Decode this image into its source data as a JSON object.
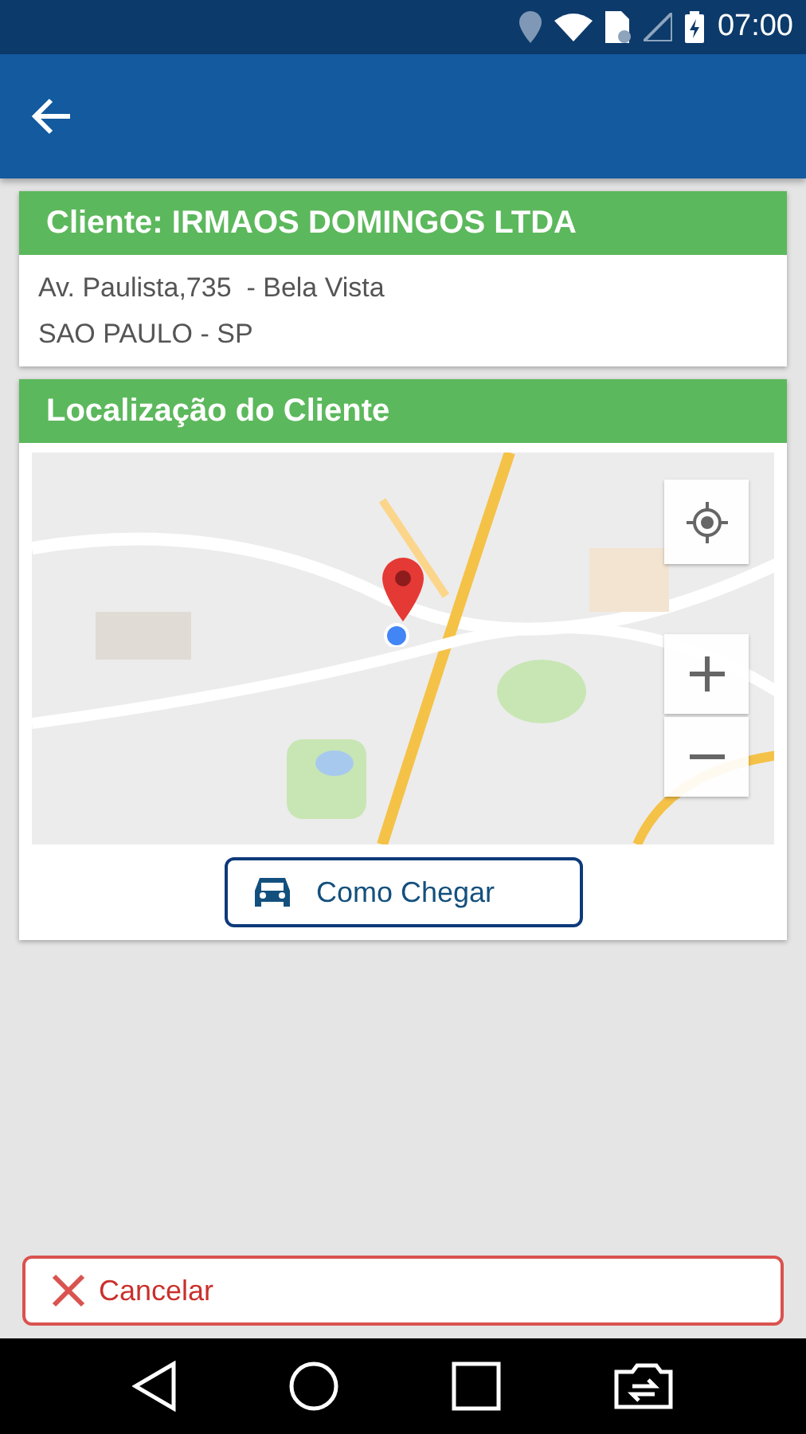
{
  "status_bar": {
    "time": "07:00"
  },
  "client_card": {
    "title": "Cliente: IRMAOS DOMINGOS LTDA",
    "address_lines": [
      "Av. Paulista,735  - Bela Vista",
      "SAO PAULO - SP"
    ]
  },
  "location_card": {
    "title": "Localização do Cliente",
    "directions_button": "Como Chegar"
  },
  "cancel_button": "Cancelar"
}
